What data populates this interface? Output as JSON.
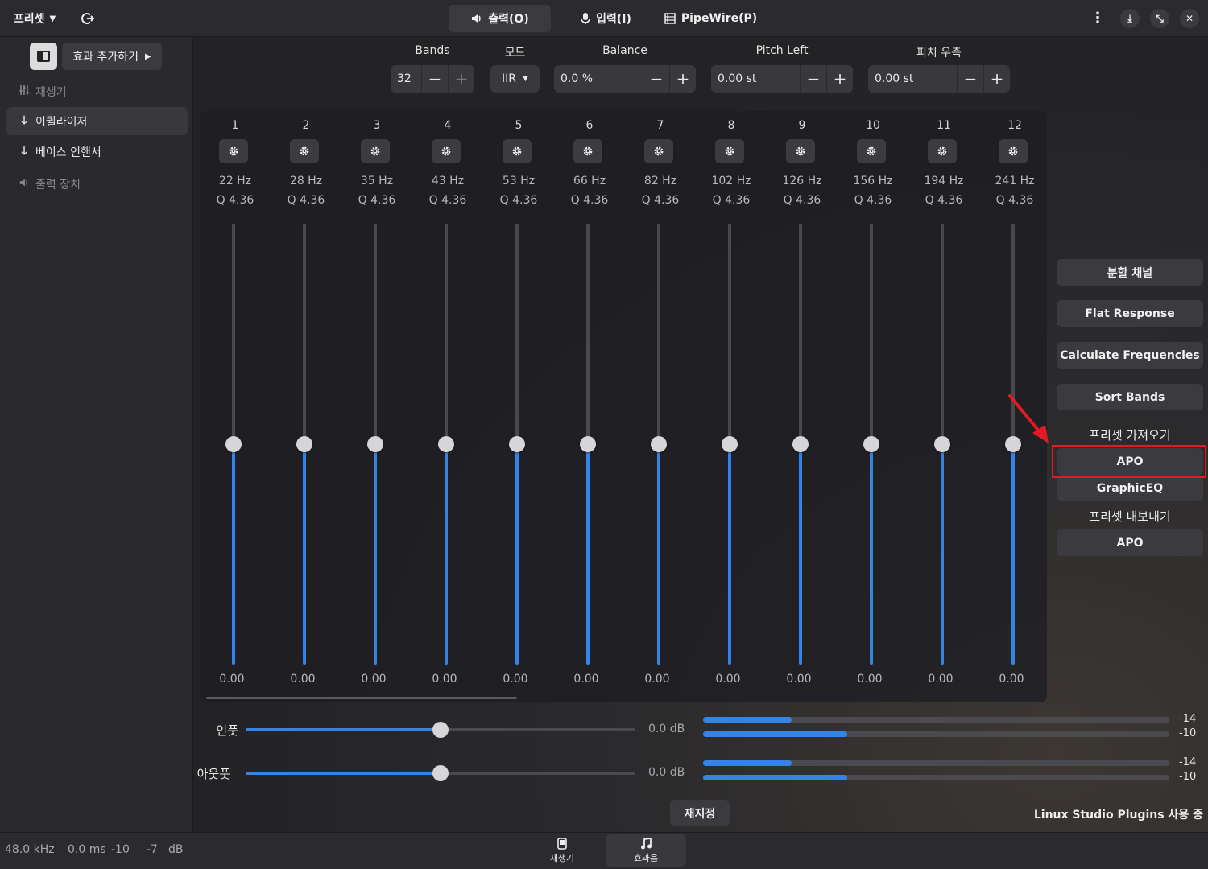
{
  "header": {
    "presets_label": "프리셋",
    "tabs": [
      {
        "label": "출력(O)",
        "icon": "speaker-icon",
        "active": true
      },
      {
        "label": "입력(I)",
        "icon": "microphone-icon",
        "active": false
      },
      {
        "label": "PipeWire(P)",
        "icon": "server-icon",
        "active": false
      }
    ]
  },
  "sidebar": {
    "add_effect_label": "효과 추가하기",
    "items": [
      {
        "label": "재생기",
        "icon": "equalizer-icon",
        "state": "dim"
      },
      {
        "label": "이퀄라이저",
        "icon": "arrow-down-icon",
        "state": "active"
      },
      {
        "label": "베이스 인핸서",
        "icon": "arrow-down-icon",
        "state": "normal"
      },
      {
        "label": "출력 장치",
        "icon": "speaker-icon",
        "state": "dim"
      }
    ]
  },
  "controls": {
    "bands_label": "Bands",
    "bands_value": "32",
    "mode_label": "모드",
    "mode_value": "IIR",
    "balance_label": "Balance",
    "balance_value": "0.0 %",
    "pitch_left_label": "Pitch Left",
    "pitch_left_value": "0.00 st",
    "pitch_right_label": "피치 우측",
    "pitch_right_value": "0.00 st"
  },
  "bands": [
    {
      "num": "1",
      "freq": "22 Hz",
      "q": "Q 4.36",
      "gain": "0.00",
      "level": 0.5
    },
    {
      "num": "2",
      "freq": "28 Hz",
      "q": "Q 4.36",
      "gain": "0.00",
      "level": 0.5
    },
    {
      "num": "3",
      "freq": "35 Hz",
      "q": "Q 4.36",
      "gain": "0.00",
      "level": 0.5
    },
    {
      "num": "4",
      "freq": "43 Hz",
      "q": "Q 4.36",
      "gain": "0.00",
      "level": 0.5
    },
    {
      "num": "5",
      "freq": "53 Hz",
      "q": "Q 4.36",
      "gain": "0.00",
      "level": 0.5
    },
    {
      "num": "6",
      "freq": "66 Hz",
      "q": "Q 4.36",
      "gain": "0.00",
      "level": 0.5
    },
    {
      "num": "7",
      "freq": "82 Hz",
      "q": "Q 4.36",
      "gain": "0.00",
      "level": 0.5
    },
    {
      "num": "8",
      "freq": "102 Hz",
      "q": "Q 4.36",
      "gain": "0.00",
      "level": 0.5
    },
    {
      "num": "9",
      "freq": "126 Hz",
      "q": "Q 4.36",
      "gain": "0.00",
      "level": 0.5
    },
    {
      "num": "10",
      "freq": "156 Hz",
      "q": "Q 4.36",
      "gain": "0.00",
      "level": 0.5
    },
    {
      "num": "11",
      "freq": "194 Hz",
      "q": "Q 4.36",
      "gain": "0.00",
      "level": 0.5
    },
    {
      "num": "12",
      "freq": "241 Hz",
      "q": "Q 4.36",
      "gain": "0.00",
      "level": 0.5
    }
  ],
  "right_panel": {
    "split_channels": "분할 채널",
    "flat_response": "Flat Response",
    "calculate_frequencies": "Calculate Frequencies",
    "sort_bands": "Sort Bands",
    "import_label": "프리셋 가져오기",
    "import_apo": "APO",
    "import_graphiceq": "GraphicEQ",
    "export_label": "프리셋 내보내기",
    "export_apo": "APO"
  },
  "gain": {
    "input_label": "인풋",
    "input_value": "0.0 dB",
    "input_level": 0.5,
    "output_label": "아웃풋",
    "output_value": "0.0 dB",
    "output_level": 0.5,
    "input_meter": [
      {
        "label": "-14",
        "fill": 0.19
      },
      {
        "label": "-10",
        "fill": 0.31
      }
    ],
    "output_meter": [
      {
        "label": "-14",
        "fill": 0.19
      },
      {
        "label": "-10",
        "fill": 0.31
      }
    ]
  },
  "reset_label": "재지정",
  "plugins_status": "Linux Studio Plugins 사용 중",
  "status_bar": {
    "sample_rate": "48.0 kHz",
    "latency": "0.0 ms",
    "level_left": "-10",
    "level_right": "-7",
    "unit": "dB"
  },
  "bottom_tabs": [
    {
      "label": "재생기",
      "icon": "player-icon",
      "active": false
    },
    {
      "label": "효과음",
      "icon": "music-note-icon",
      "active": true
    }
  ],
  "highlight_color": "#e01b24",
  "accent_color": "#3584e4"
}
